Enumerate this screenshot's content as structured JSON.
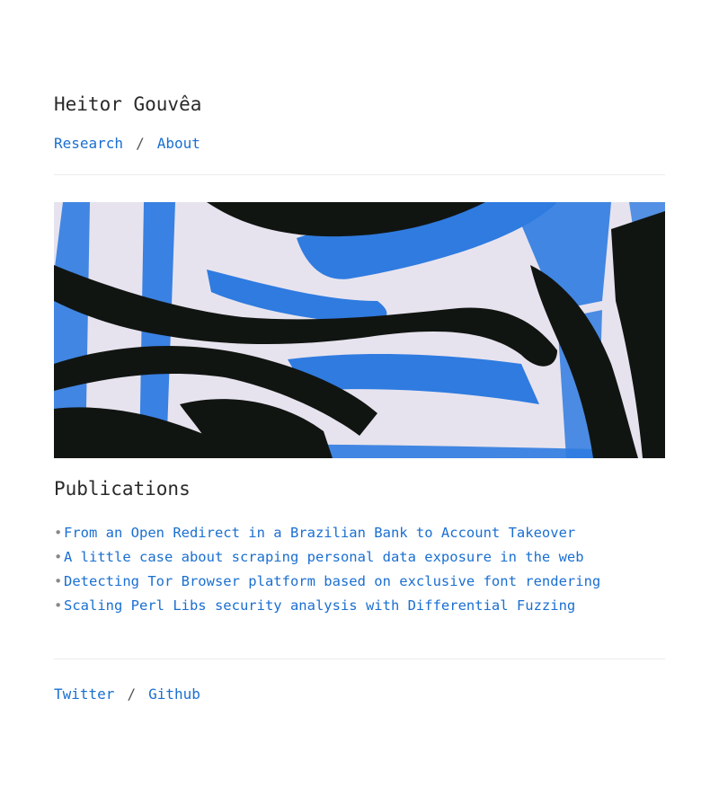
{
  "site": {
    "title": "Heitor Gouvêa"
  },
  "nav": {
    "items": [
      {
        "label": "Research"
      },
      {
        "label": "About"
      }
    ],
    "separator": "/"
  },
  "hero": {
    "colors": {
      "paper": "#e7e3ee",
      "blue": "#2f7be0",
      "black": "#111512"
    }
  },
  "publications": {
    "heading": "Publications",
    "bullet": "•",
    "items": [
      {
        "title": "From an Open Redirect in a Brazilian Bank to Account Takeover"
      },
      {
        "title": "A little case about scraping personal data exposure in the web"
      },
      {
        "title": "Detecting Tor Browser platform based on exclusive font rendering"
      },
      {
        "title": "Scaling Perl Libs security analysis with Differential Fuzzing"
      }
    ]
  },
  "footer": {
    "links": [
      {
        "label": "Twitter"
      },
      {
        "label": "Github"
      }
    ],
    "separator": "/"
  },
  "colors": {
    "link": "#1a6fd1",
    "text": "#2a2a2a",
    "rule": "#ececec"
  }
}
